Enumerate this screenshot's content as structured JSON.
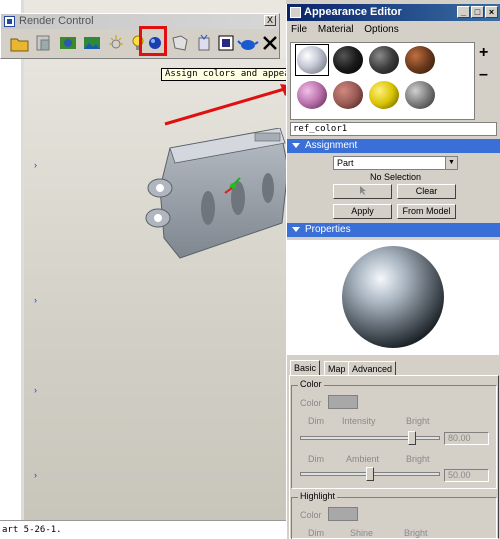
{
  "render_control": {
    "title": "Render Control",
    "close_label": "X",
    "tools": [
      "open-folder-icon",
      "scene-icon",
      "room-icon",
      "environment-icon",
      "lights-icon",
      "bulb-icon",
      "appearance-sphere-icon",
      "decal-icon",
      "effects-icon",
      "render-settings-icon",
      "render-teapot-icon",
      "close-x-icon"
    ]
  },
  "tooltip": "Assign colors and appearances.",
  "status_text": "art 5-26-1.",
  "appearance_editor": {
    "title": "Appearance Editor",
    "menu": [
      "File",
      "Material",
      "Options"
    ],
    "add_label": "+",
    "remove_label": "–",
    "material_name": "ref_color1",
    "swatches": [
      "#c8ccd8",
      "#1a1a1a",
      "#3c3c3c",
      "#6b3a1e",
      "#b86fa8",
      "#9a5a55",
      "#d8c400",
      "#7a7a7a"
    ],
    "assignment": {
      "header": "Assignment",
      "scope": "Part",
      "selection": "No Selection",
      "clear": "Clear",
      "apply": "Apply",
      "from_model": "From Model"
    },
    "properties": {
      "header": "Properties"
    },
    "tabs": [
      "Basic",
      "Map",
      "Advanced"
    ],
    "color_group": {
      "title": "Color",
      "color_label": "Color",
      "dim1": "Dim",
      "intensity": "Intensity",
      "bright1": "Bright",
      "intensity_value": "80.00",
      "dim2": "Dim",
      "ambient": "Ambient",
      "bright2": "Bright",
      "ambient_value": "50.00"
    },
    "highlight_group": {
      "title": "Highlight",
      "color_label": "Color",
      "dim": "Dim",
      "shine": "Shine",
      "bright": "Bright"
    }
  }
}
